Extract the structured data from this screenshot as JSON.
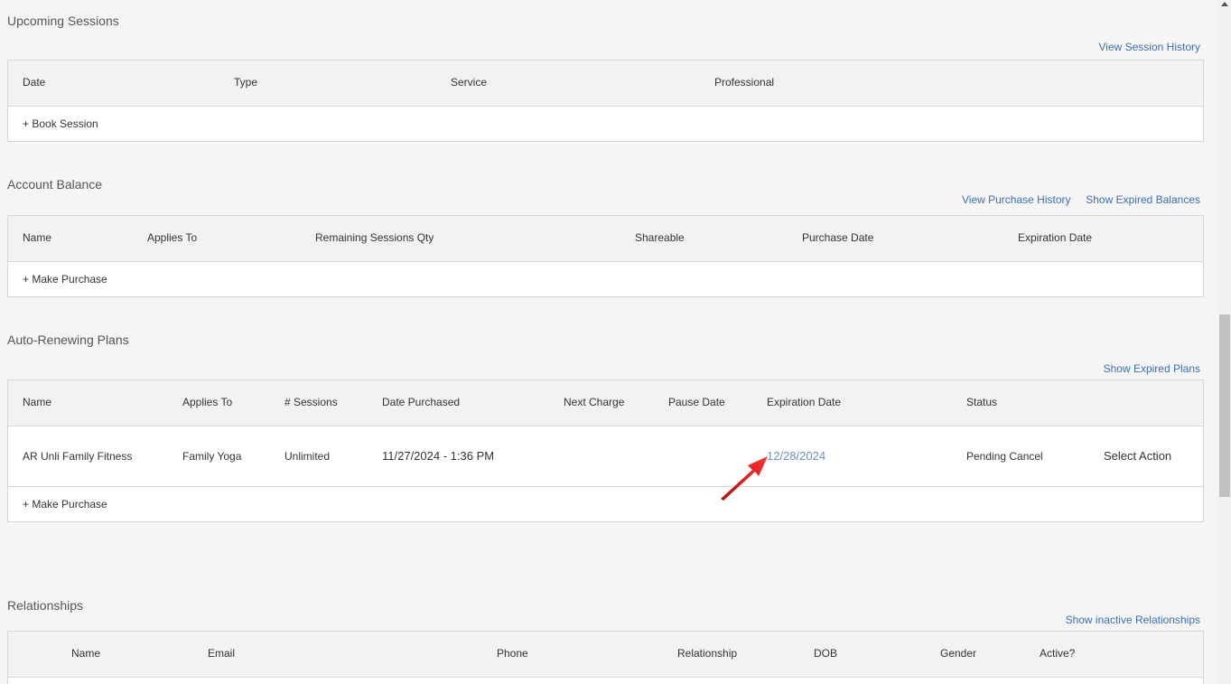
{
  "upcoming": {
    "title": "Upcoming Sessions",
    "history_link": "View Session History",
    "headers": [
      "Date",
      "Type",
      "Service",
      "Professional"
    ],
    "action": "+ Book Session"
  },
  "balance": {
    "title": "Account Balance",
    "history_link": "View Purchase History",
    "expired_link": "Show Expired Balances",
    "headers": [
      "Name",
      "Applies To",
      "Remaining Sessions Qty",
      "Shareable",
      "Purchase Date",
      "Expiration Date"
    ],
    "action": "+ Make Purchase"
  },
  "plans": {
    "title": "Auto-Renewing Plans",
    "expired_link": "Show Expired Plans",
    "headers": [
      "Name",
      "Applies To",
      "# Sessions",
      "Date Purchased",
      "Next Charge",
      "Pause Date",
      "Expiration Date",
      "Status"
    ],
    "row": {
      "name": "AR Unli Family Fitness",
      "applies_to": "Family Yoga",
      "sessions": "Unlimited",
      "date_purchased": "11/27/2024 - 1:36 PM",
      "expiration": "12/28/2024",
      "status": "Pending Cancel",
      "action": "Select Action"
    },
    "action": "+ Make Purchase"
  },
  "relationships": {
    "title": "Relationships",
    "inactive_link": "Show inactive Relationships",
    "headers": [
      "Name",
      "Email",
      "Phone",
      "Relationship",
      "DOB",
      "Gender",
      "Active?"
    ]
  },
  "colors": {
    "link": "#3d6eb4",
    "arrow": "#e02020"
  }
}
